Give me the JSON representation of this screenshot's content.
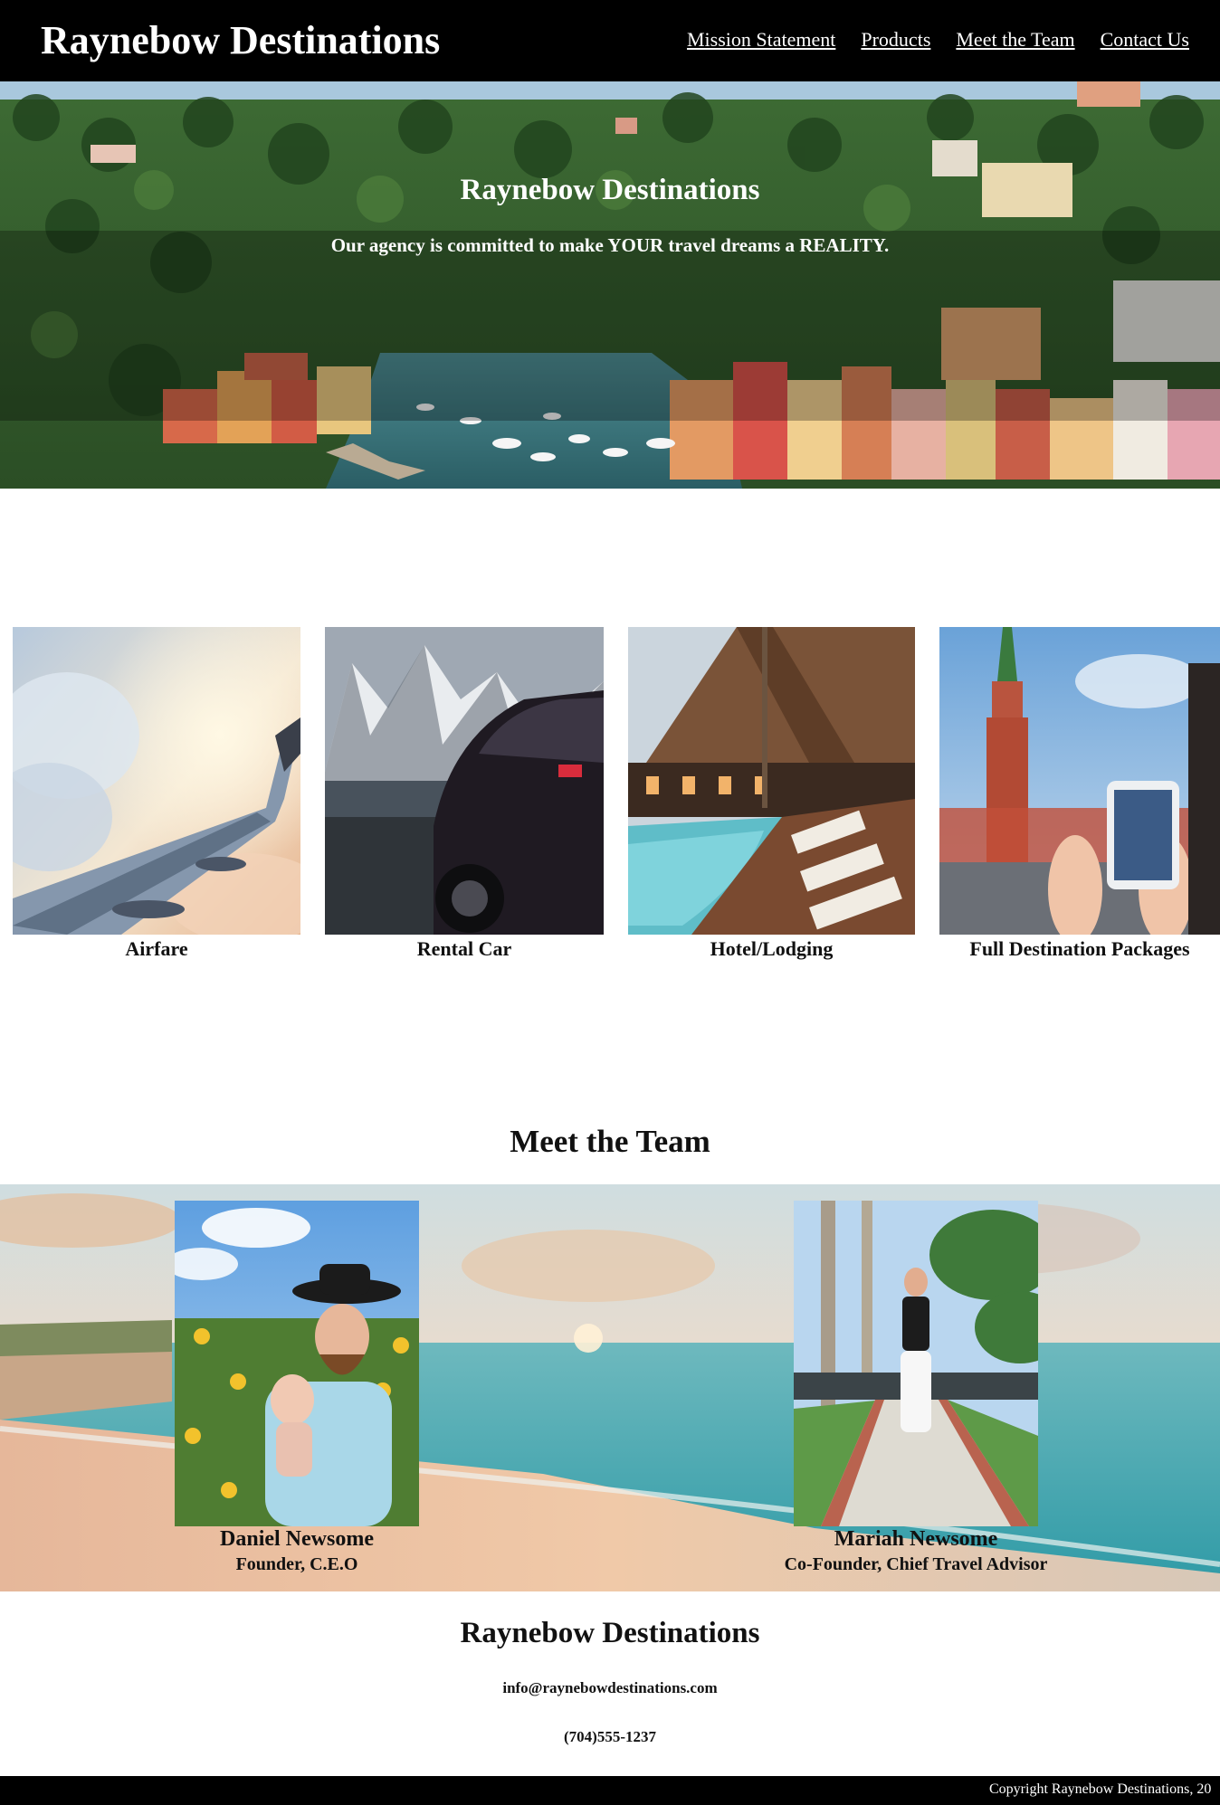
{
  "header": {
    "brand": "Raynebow Destinations",
    "nav": [
      {
        "label": "Mission Statement"
      },
      {
        "label": "Products"
      },
      {
        "label": "Meet the Team"
      },
      {
        "label": "Contact Us"
      }
    ]
  },
  "hero": {
    "title": "Raynebow Destinations",
    "subtitle": "Our agency is committed to make YOUR travel dreams a REALITY."
  },
  "products": [
    {
      "label": "Airfare",
      "image": "airplane-wing"
    },
    {
      "label": "Rental Car",
      "image": "car-mountains"
    },
    {
      "label": "Hotel/Lodging",
      "image": "resort-pool"
    },
    {
      "label": "Full Destination Packages",
      "image": "kremlin-tower-phone"
    }
  ],
  "team": {
    "heading": "Meet the Team",
    "members": [
      {
        "name": "Daniel Newsome",
        "role": "Founder, C.E.O"
      },
      {
        "name": "Mariah Newsome",
        "role": "Co-Founder, Chief Travel Advisor"
      }
    ]
  },
  "footer": {
    "title": "Raynebow Destinations",
    "email": "info@raynebowdestinations.com",
    "phone": "(704)555-1237",
    "copyright": "Copyright Raynebow Destinations, 20"
  },
  "colors": {
    "header_bg": "#000000",
    "text_light": "#ffffff",
    "text_dark": "#111111"
  }
}
